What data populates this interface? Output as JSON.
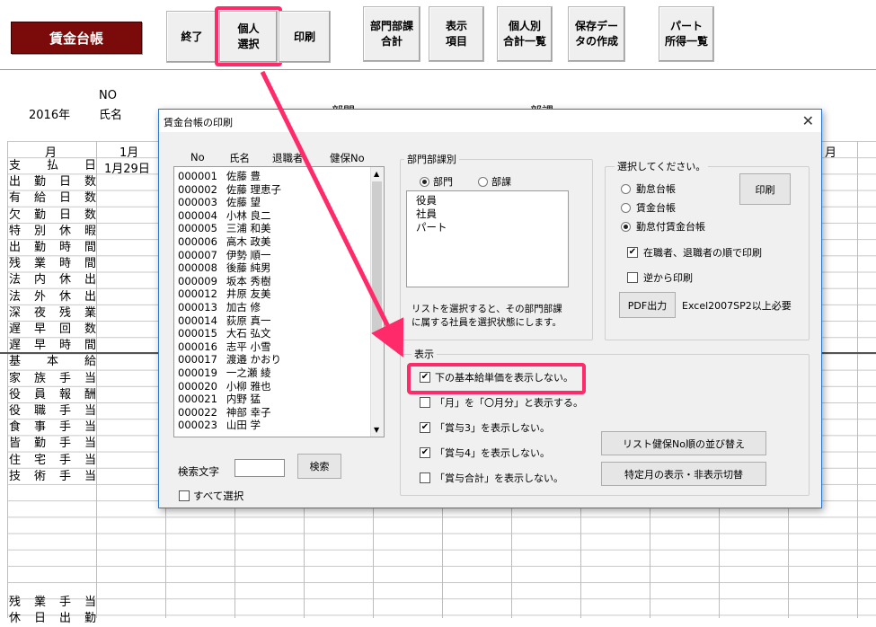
{
  "toolbar": {
    "title": "賃金台帳",
    "buttons": [
      "終了",
      "個人\n選択",
      "印刷",
      "部門部課\n合計",
      "表示\n項目",
      "個人別\n合計一覧",
      "保存デー\nタの作成",
      "パート\n所得一覧"
    ]
  },
  "sheet": {
    "no_label": "NO",
    "year": "2016年",
    "name_label": "氏名",
    "dept1": "部門",
    "dept2": "部課",
    "month_header": "月",
    "first_month": "1月",
    "last_month_partial": "月",
    "pay_date": "1月29日",
    "row_labels": [
      "支払日",
      "出勤日数",
      "有給日数",
      "欠勤日数",
      "特別休暇",
      "出勤時間",
      "残業時間",
      "法内休出",
      "法外休出",
      "深夜残業",
      "遅早回数",
      "遅早時間",
      "基本給",
      "家族手当",
      "役員報酬",
      "役職手当",
      "食事手当",
      "皆勤手当",
      "住宅手当",
      "技術手当"
    ],
    "bottom_labels": [
      "残業手当",
      "休日出勤"
    ]
  },
  "dialog": {
    "title": "賃金台帳の印刷",
    "close": "✕",
    "list_headers": [
      "No",
      "氏名",
      "退職者",
      "健保No"
    ],
    "employees": [
      {
        "no": "000001",
        "name": "佐藤 豊"
      },
      {
        "no": "000002",
        "name": "佐藤 理恵子"
      },
      {
        "no": "000003",
        "name": "佐藤 望"
      },
      {
        "no": "000004",
        "name": "小林 良二"
      },
      {
        "no": "000005",
        "name": "三浦 和美"
      },
      {
        "no": "000006",
        "name": "高木 政美"
      },
      {
        "no": "000007",
        "name": "伊勢 順一"
      },
      {
        "no": "000008",
        "name": "後藤 純男"
      },
      {
        "no": "000009",
        "name": "坂本 秀樹"
      },
      {
        "no": "000012",
        "name": "井原 友美"
      },
      {
        "no": "000013",
        "name": "加古 修"
      },
      {
        "no": "000014",
        "name": "荻原 真一"
      },
      {
        "no": "000015",
        "name": "大石 弘文"
      },
      {
        "no": "000016",
        "name": "志平 小雪"
      },
      {
        "no": "000017",
        "name": "渡邉 かおり"
      },
      {
        "no": "000019",
        "name": "一之瀬 綾"
      },
      {
        "no": "000020",
        "name": "小柳 雅也"
      },
      {
        "no": "000021",
        "name": "内野 猛"
      },
      {
        "no": "000022",
        "name": "神部 幸子"
      },
      {
        "no": "000023",
        "name": "山田 学"
      }
    ],
    "search_label": "検索文字",
    "search_value": "",
    "search_button": "検索",
    "select_all": "すべて選択",
    "dept_group": {
      "title": "部門部課別",
      "radio_dept": "部門",
      "radio_section": "部課",
      "items": [
        "役員",
        "社員",
        "パート"
      ],
      "note": "リストを選択すると、その部門部課\nに属する社員を選択状態にします。"
    },
    "select_group": {
      "title": "選択してください。",
      "options": [
        "勤怠台帳",
        "賃金台帳",
        "勤怠付賃金台帳"
      ],
      "selected": 2,
      "print_button": "印刷",
      "check_order": "在職者、退職者の順で印刷",
      "check_reverse": "逆から印刷",
      "pdf_button": "PDF出力",
      "pdf_note": "Excel2007SP2以上必要"
    },
    "display_group": {
      "title": "表示",
      "checks": [
        {
          "label": "下の基本給単価を表示しない。",
          "checked": true
        },
        {
          "label": "「月」を「〇月分」と表示する。",
          "checked": false
        },
        {
          "label": "「賞与3」を表示しない。",
          "checked": true
        },
        {
          "label": "「賞与4」を表示しない。",
          "checked": true
        },
        {
          "label": "「賞与合計」を表示しない。",
          "checked": false
        }
      ],
      "sort_button": "リスト健保No順の並び替え",
      "toggle_button": "特定月の表示・非表示切替"
    }
  },
  "colors": {
    "title_bg": "#7b0b0b",
    "highlight": "#ff2a6a",
    "dialog_border": "#2b78c8"
  }
}
